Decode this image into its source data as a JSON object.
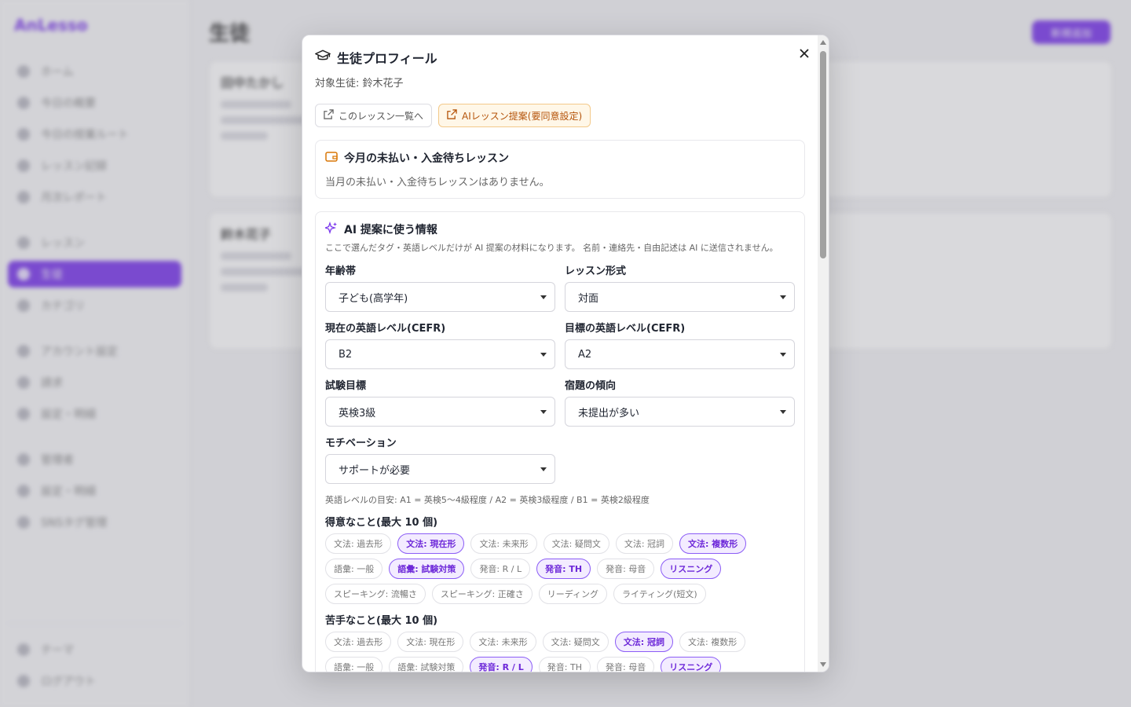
{
  "background": {
    "brand": "AnLesso",
    "sidebar_items": [
      "ホーム",
      "今日の概要",
      "今日の授業ルート",
      "レッスン記録",
      "月次レポート",
      "レッスン",
      "生徒",
      "カテゴリ",
      "アカウント設定",
      "請求",
      "設定・明細",
      "管理者",
      "設定・明細",
      "SNSタグ管理"
    ],
    "sidebar_bottom": [
      "テーマ",
      "ログアウト"
    ],
    "page_title": "生徒",
    "add_button": "新規追加",
    "cards": [
      "田中たかし",
      "鈴木花子"
    ]
  },
  "modal": {
    "title": "生徒プロフィール",
    "subtitle": "対象生徒: 鈴木花子",
    "btn_lessons": "このレッスン一覧へ",
    "btn_ai": "AIレッスン提案(要同意設定)",
    "unpaid": {
      "title": "今月の未払い・入金待ちレッスン",
      "note": "当月の未払い・入金待ちレッスンはありません。"
    },
    "ai": {
      "title": "AI 提案に使う情報",
      "desc": "ここで選んだタグ・英語レベルだけが AI 提案の材料になります。 名前・連絡先・自由記述は AI に送信されません。",
      "fields": {
        "age_label": "年齢帯",
        "age_value": "子ども(高学年)",
        "format_label": "レッスン形式",
        "format_value": "対面",
        "cur_level_label": "現在の英語レベル(CEFR)",
        "cur_level_value": "B2",
        "goal_level_label": "目標の英語レベル(CEFR)",
        "goal_level_value": "A2",
        "exam_label": "試験目標",
        "exam_value": "英検3級",
        "homework_label": "宿題の傾向",
        "homework_value": "未提出が多い",
        "motivation_label": "モチベーション",
        "motivation_value": "サポートが必要"
      },
      "level_note": "英語レベルの目安: A1 = 英検5〜4級程度 / A2 = 英検3級程度 / B1 = 英検2級程度",
      "strengths_title": "得意なこと(最大 10 個)",
      "strengths": [
        {
          "label": "文法: 過去形",
          "selected": false
        },
        {
          "label": "文法: 現在形",
          "selected": true
        },
        {
          "label": "文法: 未来形",
          "selected": false
        },
        {
          "label": "文法: 疑問文",
          "selected": false
        },
        {
          "label": "文法: 冠詞",
          "selected": false
        },
        {
          "label": "文法: 複数形",
          "selected": true
        },
        {
          "label": "語彙: 一般",
          "selected": false
        },
        {
          "label": "語彙: 試験対策",
          "selected": true
        },
        {
          "label": "発音: R / L",
          "selected": false
        },
        {
          "label": "発音: TH",
          "selected": true
        },
        {
          "label": "発音: 母音",
          "selected": false
        },
        {
          "label": "リスニング",
          "selected": true
        },
        {
          "label": "スピーキング: 流暢さ",
          "selected": false
        },
        {
          "label": "スピーキング: 正確さ",
          "selected": false
        },
        {
          "label": "リーディング",
          "selected": false
        },
        {
          "label": "ライティング(短文)",
          "selected": false
        }
      ],
      "weaknesses_title": "苦手なこと(最大 10 個)",
      "weaknesses": [
        {
          "label": "文法: 過去形",
          "selected": false
        },
        {
          "label": "文法: 現在形",
          "selected": false
        },
        {
          "label": "文法: 未来形",
          "selected": false
        },
        {
          "label": "文法: 疑問文",
          "selected": false
        },
        {
          "label": "文法: 冠詞",
          "selected": true
        },
        {
          "label": "文法: 複数形",
          "selected": false
        },
        {
          "label": "語彙: 一般",
          "selected": false
        },
        {
          "label": "語彙: 試験対策",
          "selected": false
        },
        {
          "label": "発音: R / L",
          "selected": true
        },
        {
          "label": "発音: TH",
          "selected": false
        },
        {
          "label": "発音: 母音",
          "selected": false
        },
        {
          "label": "リスニング",
          "selected": true
        }
      ]
    }
  },
  "colors": {
    "accent": "#7c3aed",
    "warn": "#b45309"
  }
}
